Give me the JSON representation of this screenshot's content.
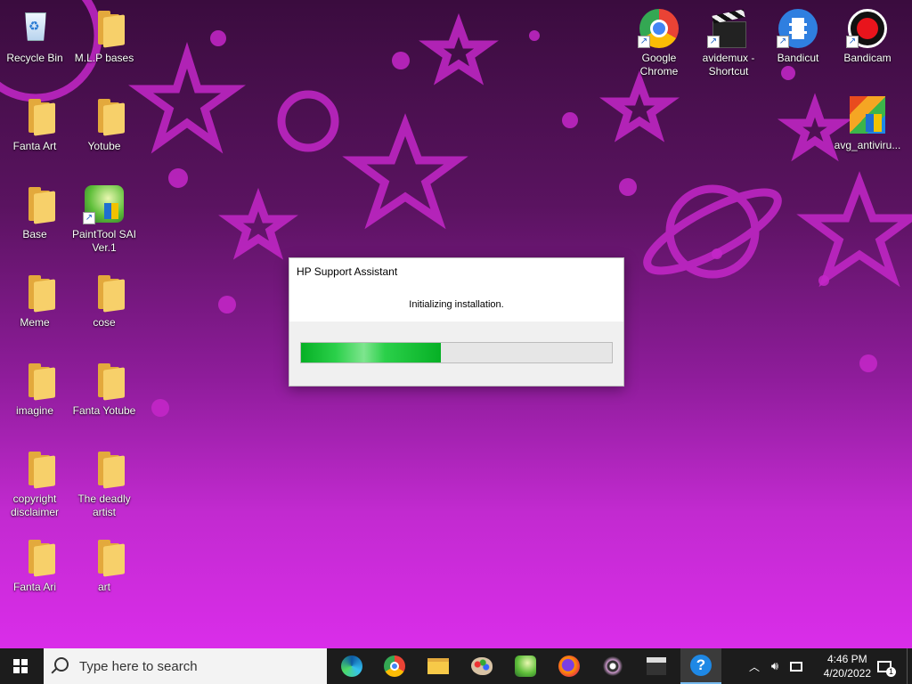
{
  "desktop": {
    "icons_left": [
      {
        "label": "Recycle Bin",
        "kind": "recycle"
      },
      {
        "label": "M.L.P bases",
        "kind": "folder"
      },
      {
        "label": "Fanta Art",
        "kind": "folder"
      },
      {
        "label": "Yotube",
        "kind": "folder"
      },
      {
        "label": "Base",
        "kind": "folder"
      },
      {
        "label": "PaintTool SAI Ver.1",
        "kind": "app"
      },
      {
        "label": "Meme",
        "kind": "folder"
      },
      {
        "label": "cose",
        "kind": "folder"
      },
      {
        "label": "imagine",
        "kind": "folder"
      },
      {
        "label": "Fanta Yotube",
        "kind": "folder"
      },
      {
        "label": "copyright disclaimer",
        "kind": "folder"
      },
      {
        "label": "The deadly artist",
        "kind": "folder"
      },
      {
        "label": "Fanta Ari",
        "kind": "folder"
      },
      {
        "label": "art",
        "kind": "folder"
      }
    ],
    "icons_right": [
      {
        "label": "Google Chrome",
        "icon": "chrome-icon"
      },
      {
        "label": "avidemux - Shortcut",
        "icon": "clapperboard-icon"
      },
      {
        "label": "Bandicut",
        "icon": "film-icon"
      },
      {
        "label": "Bandicam",
        "icon": "record-icon"
      },
      {
        "label": "avg_antiviru...",
        "icon": "avg-icon"
      }
    ]
  },
  "dialog": {
    "title": "HP Support Assistant",
    "message": "Initializing installation.",
    "progress": 0.45
  },
  "taskbar": {
    "search_placeholder": "Type here to search",
    "time": "4:46 PM",
    "date": "4/20/2022",
    "notification_count": "1"
  },
  "colors": {
    "progress_green": "#06b025",
    "wallpaper_pink": "#e02ef0"
  }
}
